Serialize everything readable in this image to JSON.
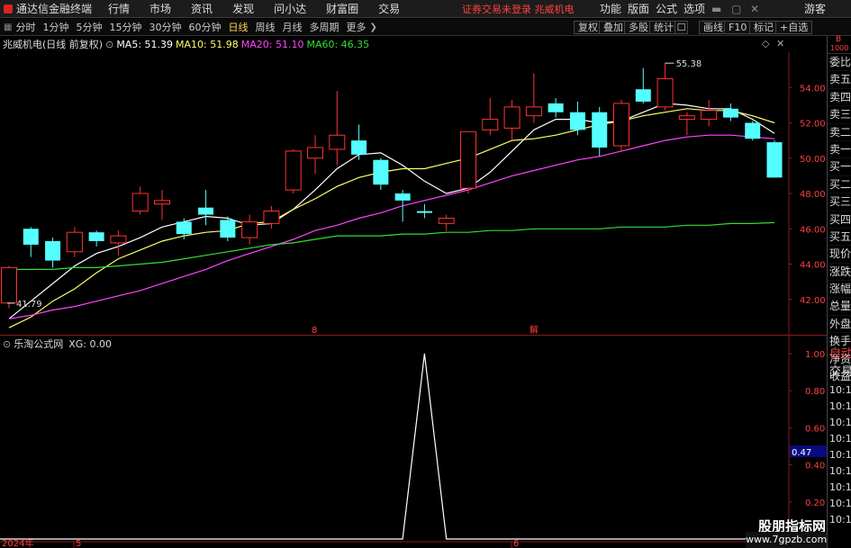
{
  "app": {
    "name": "通达信金融终端",
    "menus": [
      "行情",
      "市场",
      "资讯",
      "发现",
      "问小达",
      "财富圈",
      "交易"
    ],
    "notice": "证券交易未登录  兆威机电",
    "right_menus": [
      "功能",
      "版面",
      "公式",
      "选项",
      "游客"
    ]
  },
  "toolbar": {
    "periods": [
      "分时",
      "1分钟",
      "5分钟",
      "15分钟",
      "30分钟",
      "60分钟",
      "日线",
      "周线",
      "月线",
      "多周期",
      "更多"
    ],
    "active": "日线",
    "right_buttons": [
      "复权",
      "叠加",
      "多股",
      "统计",
      "画线",
      "F10",
      "标记",
      "+自选"
    ]
  },
  "main": {
    "stock_title": "兆威机电(日线 前复权)",
    "ma5": "MA5: 51.39",
    "ma10": "MA10: 51.98",
    "ma20": "MA20: 51.10",
    "ma60": "MA60: 46.35",
    "colors": {
      "ma5": "#ffffff",
      "ma10": "#ffff66",
      "ma20": "#ff44ff",
      "ma60": "#33dd33",
      "up": "#ff3333",
      "down": "#55ffff"
    },
    "high_label": "55.38",
    "low_label": "41.79",
    "markers": [
      "8",
      "解"
    ]
  },
  "sub": {
    "title": "乐淘公式网",
    "value": "XG: 0.00",
    "cursor": "0.47",
    "time_labels": [
      "10:14",
      "10:14",
      "10:14",
      "10:14",
      "10:14",
      "10:14",
      "10:14",
      "10:14",
      "10:14"
    ]
  },
  "side": {
    "labels": [
      "委比",
      "卖五",
      "卖四",
      "卖三",
      "卖二",
      "卖一",
      "买一",
      "买二",
      "买三",
      "买四",
      "买五",
      "现价",
      "涨跌",
      "涨幅",
      "总量",
      "外盘",
      "换手",
      "净资",
      "收益"
    ],
    "sub_labels": [
      "自动",
      "交易"
    ],
    "corner": [
      "B",
      "1000"
    ]
  },
  "xaxis": {
    "labels": [
      "2024年",
      "5",
      "6"
    ]
  },
  "watermark": {
    "title": "股朋指标网",
    "url": "www.7gpzb.com"
  },
  "chart_data": [
    {
      "type": "candlestick",
      "title": "兆威机电(日线 前复权)",
      "ylim": [
        40.0,
        56.0
      ],
      "yticks": [
        42.0,
        44.0,
        46.0,
        48.0,
        50.0,
        52.0,
        54.0
      ],
      "candles": [
        {
          "o": 41.8,
          "h": 43.9,
          "l": 41.5,
          "c": 43.8
        },
        {
          "o": 46.0,
          "h": 46.1,
          "l": 44.4,
          "c": 45.1
        },
        {
          "o": 45.3,
          "h": 45.5,
          "l": 43.8,
          "c": 44.2
        },
        {
          "o": 44.7,
          "h": 46.1,
          "l": 44.4,
          "c": 45.8
        },
        {
          "o": 45.8,
          "h": 45.9,
          "l": 45.0,
          "c": 45.3
        },
        {
          "o": 45.2,
          "h": 45.9,
          "l": 44.5,
          "c": 45.6
        },
        {
          "o": 47.0,
          "h": 48.4,
          "l": 46.8,
          "c": 48.0
        },
        {
          "o": 47.4,
          "h": 48.2,
          "l": 46.5,
          "c": 47.6
        },
        {
          "o": 46.4,
          "h": 46.6,
          "l": 45.4,
          "c": 45.7
        },
        {
          "o": 47.2,
          "h": 48.2,
          "l": 46.2,
          "c": 46.8
        },
        {
          "o": 46.5,
          "h": 46.7,
          "l": 45.3,
          "c": 45.5
        },
        {
          "o": 45.5,
          "h": 46.8,
          "l": 45.1,
          "c": 46.4
        },
        {
          "o": 46.3,
          "h": 47.3,
          "l": 46.0,
          "c": 47.0
        },
        {
          "o": 48.2,
          "h": 50.5,
          "l": 48.0,
          "c": 50.4
        },
        {
          "o": 50.0,
          "h": 51.3,
          "l": 49.1,
          "c": 50.6
        },
        {
          "o": 50.5,
          "h": 53.8,
          "l": 49.6,
          "c": 51.3
        },
        {
          "o": 51.0,
          "h": 51.9,
          "l": 49.9,
          "c": 50.2
        },
        {
          "o": 49.9,
          "h": 50.0,
          "l": 48.2,
          "c": 48.5
        },
        {
          "o": 48.0,
          "h": 48.2,
          "l": 46.4,
          "c": 47.6
        },
        {
          "o": 47.0,
          "h": 47.4,
          "l": 46.6,
          "c": 46.9
        },
        {
          "o": 46.3,
          "h": 46.8,
          "l": 45.9,
          "c": 46.6
        },
        {
          "o": 48.3,
          "h": 51.5,
          "l": 48.0,
          "c": 51.5
        },
        {
          "o": 51.6,
          "h": 53.4,
          "l": 51.3,
          "c": 52.2
        },
        {
          "o": 51.7,
          "h": 53.3,
          "l": 51.0,
          "c": 52.9
        },
        {
          "o": 52.4,
          "h": 54.8,
          "l": 52.0,
          "c": 52.9
        },
        {
          "o": 53.1,
          "h": 53.4,
          "l": 52.3,
          "c": 52.6
        },
        {
          "o": 52.6,
          "h": 53.2,
          "l": 51.3,
          "c": 51.6
        },
        {
          "o": 52.6,
          "h": 52.9,
          "l": 50.1,
          "c": 50.6
        },
        {
          "o": 50.7,
          "h": 53.3,
          "l": 50.4,
          "c": 53.1
        },
        {
          "o": 53.9,
          "h": 55.1,
          "l": 53.1,
          "c": 53.2
        },
        {
          "o": 52.9,
          "h": 55.4,
          "l": 52.7,
          "c": 54.5
        },
        {
          "o": 52.2,
          "h": 52.6,
          "l": 51.3,
          "c": 52.4
        },
        {
          "o": 52.2,
          "h": 53.3,
          "l": 51.8,
          "c": 52.7
        },
        {
          "o": 52.8,
          "h": 53.1,
          "l": 52.1,
          "c": 52.3
        },
        {
          "o": 52.0,
          "h": 52.1,
          "l": 51.0,
          "c": 51.1
        },
        {
          "o": 50.9,
          "h": 51.0,
          "l": 48.9,
          "c": 48.9
        }
      ],
      "series": [
        {
          "name": "MA5",
          "values": [
            40.9,
            41.9,
            42.9,
            43.9,
            44.6,
            45.0,
            45.5,
            46.1,
            46.4,
            46.7,
            46.6,
            46.2,
            46.3,
            47.1,
            48.2,
            49.4,
            50.2,
            50.3,
            49.6,
            48.7,
            48.0,
            48.3,
            49.2,
            50.4,
            51.6,
            52.2,
            52.2,
            52.0,
            52.1,
            52.6,
            53.1,
            53.0,
            52.8,
            52.8,
            52.2,
            51.4
          ]
        },
        {
          "name": "MA10",
          "values": [
            40.4,
            41.0,
            41.9,
            42.6,
            43.5,
            44.3,
            44.8,
            45.3,
            45.6,
            45.8,
            45.9,
            46.3,
            46.4,
            47.1,
            47.7,
            48.4,
            48.9,
            49.2,
            49.4,
            49.4,
            49.7,
            50.0,
            50.5,
            51.0,
            51.1,
            51.3,
            51.6,
            51.9,
            52.1,
            52.4,
            52.6,
            52.8,
            52.7,
            52.7,
            52.4,
            52.0
          ]
        },
        {
          "name": "MA20",
          "values": [
            40.9,
            41.1,
            41.4,
            41.6,
            41.9,
            42.2,
            42.5,
            42.9,
            43.3,
            43.7,
            44.2,
            44.6,
            45.0,
            45.4,
            45.9,
            46.2,
            46.6,
            46.9,
            47.3,
            47.6,
            47.9,
            48.2,
            48.6,
            49.0,
            49.3,
            49.6,
            49.9,
            50.1,
            50.4,
            50.7,
            51.0,
            51.2,
            51.3,
            51.3,
            51.2,
            51.1
          ]
        },
        {
          "name": "MA60",
          "values": [
            43.7,
            43.7,
            43.7,
            43.8,
            43.8,
            43.9,
            44.0,
            44.1,
            44.3,
            44.5,
            44.7,
            44.9,
            45.1,
            45.2,
            45.4,
            45.6,
            45.6,
            45.6,
            45.7,
            45.7,
            45.8,
            45.8,
            45.9,
            45.9,
            46.0,
            46.0,
            46.0,
            46.0,
            46.1,
            46.1,
            46.1,
            46.2,
            46.2,
            46.3,
            46.3,
            46.35
          ]
        }
      ]
    },
    {
      "type": "line",
      "title": "乐淘公式网",
      "ylim": [
        0.0,
        1.0
      ],
      "yticks": [
        0.2,
        0.4,
        0.6,
        0.8,
        1.0
      ],
      "series": [
        {
          "name": "XG",
          "values": [
            0,
            0,
            0,
            0,
            0,
            0,
            0,
            0,
            0,
            0,
            0,
            0,
            0,
            0,
            0,
            0,
            0,
            0,
            0,
            1,
            0,
            0,
            0,
            0,
            0,
            0,
            0,
            0,
            0,
            0,
            0,
            0,
            0,
            0,
            0,
            0
          ]
        }
      ]
    }
  ]
}
